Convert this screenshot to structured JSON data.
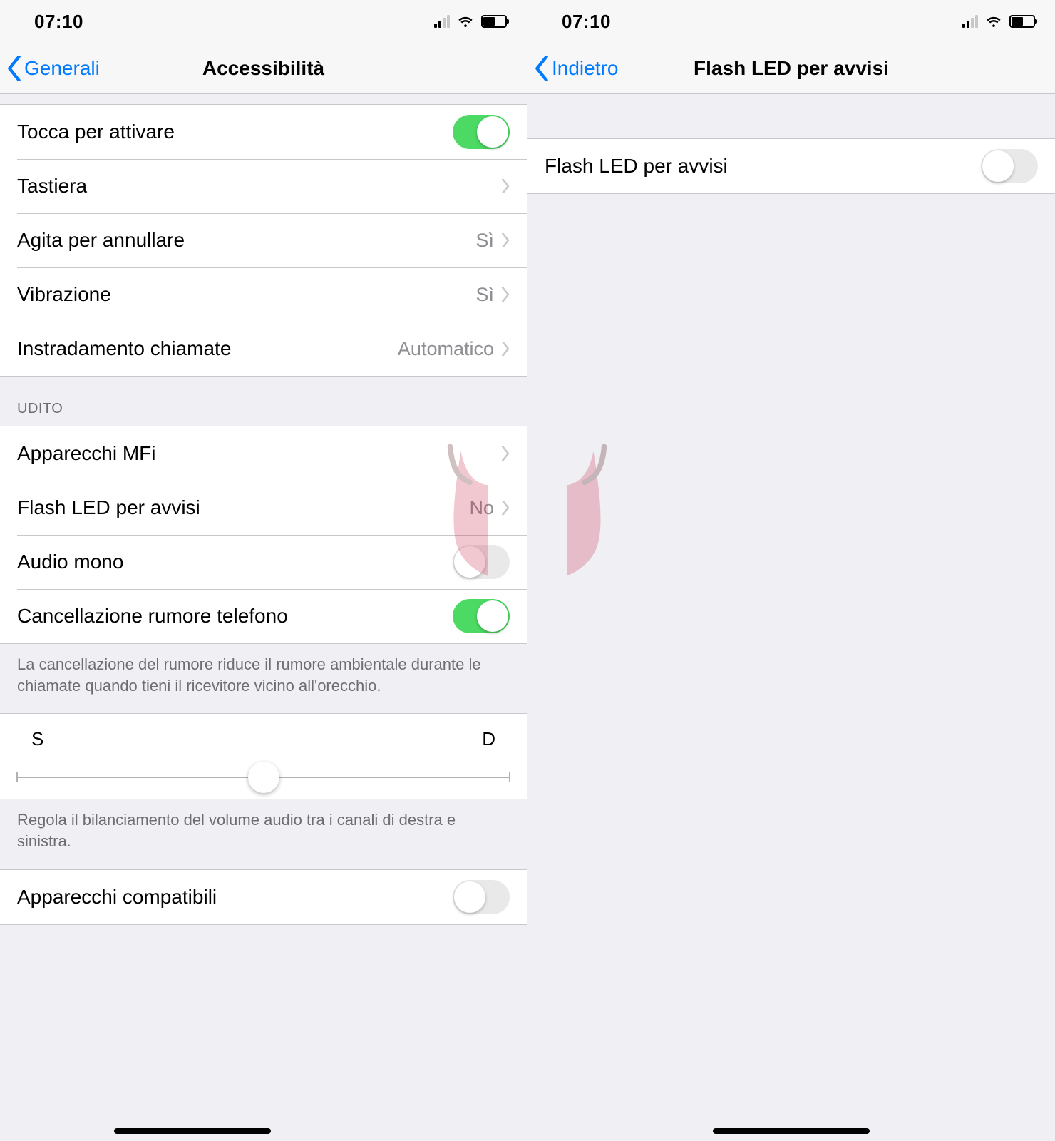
{
  "left": {
    "status": {
      "time": "07:10"
    },
    "nav": {
      "back": "Generali",
      "title": "Accessibilità"
    },
    "groupA": {
      "touch": {
        "label": "Tocca per attivare",
        "on": true
      },
      "keyboard": {
        "label": "Tastiera"
      },
      "shake": {
        "label": "Agita per annullare",
        "value": "Sì"
      },
      "vibration": {
        "label": "Vibrazione",
        "value": "Sì"
      },
      "routing": {
        "label": "Instradamento chiamate",
        "value": "Automatico"
      }
    },
    "hearing_header": "UDITO",
    "groupB": {
      "mfi": {
        "label": "Apparecchi MFi"
      },
      "led": {
        "label": "Flash LED per avvisi",
        "value": "No"
      },
      "mono": {
        "label": "Audio mono",
        "on": false
      },
      "noise": {
        "label": "Cancellazione rumore telefono",
        "on": true
      }
    },
    "noise_footer": "La cancellazione del rumore riduce il rumore ambientale durante le chiamate quando tieni il ricevitore vicino all'orecchio.",
    "balance": {
      "left_label": "S",
      "right_label": "D",
      "position_pct": 50
    },
    "balance_footer": "Regola il bilanciamento del volume audio tra i canali di destra e sinistra.",
    "compat": {
      "label": "Apparecchi compatibili",
      "on": false
    }
  },
  "right": {
    "status": {
      "time": "07:10"
    },
    "nav": {
      "back": "Indietro",
      "title": "Flash LED per avvisi"
    },
    "row": {
      "label": "Flash LED per avvisi",
      "on": false
    }
  }
}
